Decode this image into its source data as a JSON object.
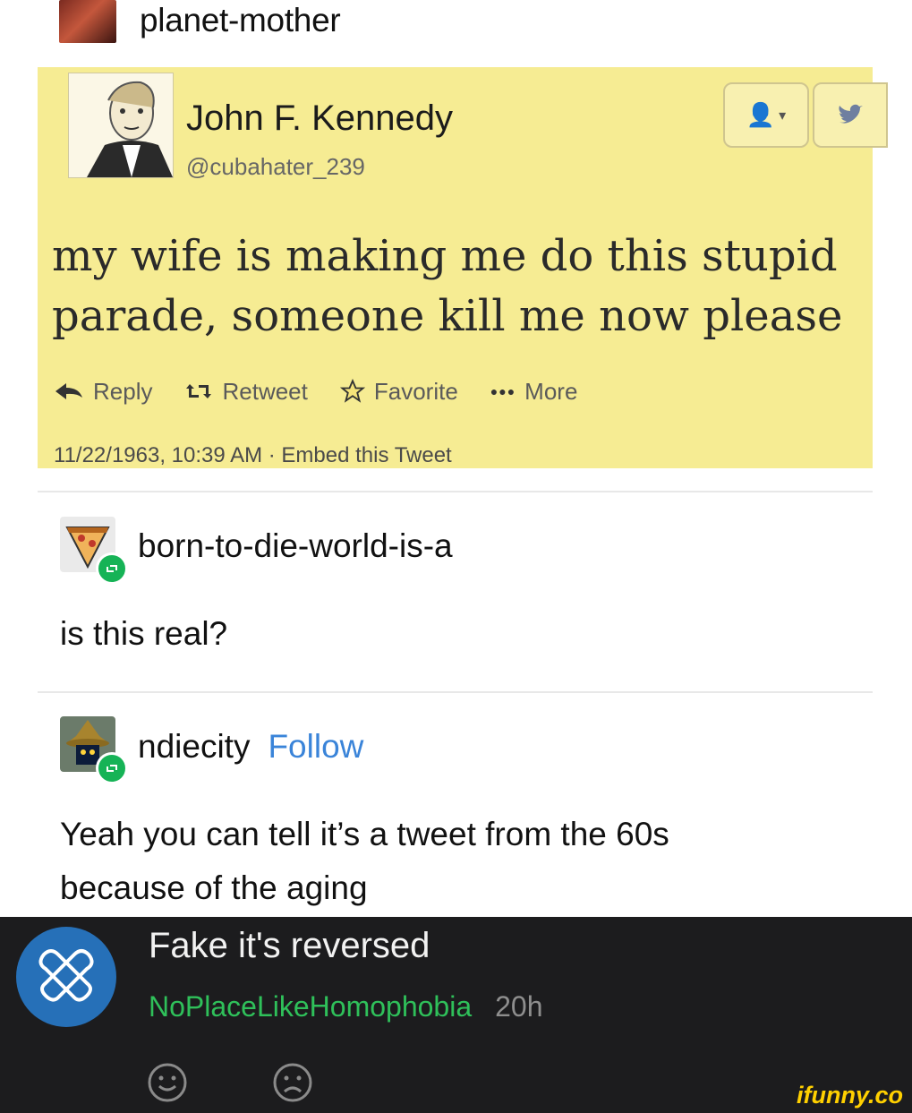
{
  "post": {
    "author": "planet-mother"
  },
  "tweet": {
    "name": "John F. Kennedy",
    "handle": "@cubahater_239",
    "text": "my wife is making me do this stupid parade, someone kill me now please",
    "actions": {
      "reply": "Reply",
      "retweet": "Retweet",
      "favorite": "Favorite",
      "more": "More"
    },
    "meta": "11/22/1963, 10:39 AM · Embed this Tweet",
    "background": "#f6ec93"
  },
  "reply1": {
    "author": "born-to-die-world-is-a",
    "text": "is this real?"
  },
  "reply2": {
    "author": "ndiecity",
    "follow": "Follow",
    "text": "Yeah you can tell it’s a tweet from the 60s because of the aging"
  },
  "comment": {
    "text": "Fake it's reversed",
    "user": "NoPlaceLikeHomophobia",
    "time": "20h",
    "user_color": "#2fc05a"
  },
  "brand": "ifunny.co"
}
